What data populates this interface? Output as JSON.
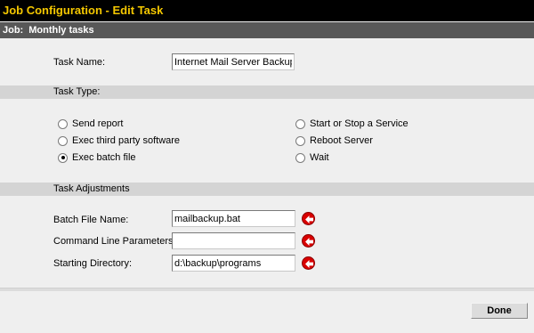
{
  "window": {
    "title": "Job Configuration - Edit Task"
  },
  "job": {
    "prefix": "Job:",
    "name": "Monthly tasks"
  },
  "task_name": {
    "label": "Task Name:",
    "value": "Internet Mail Server Backup"
  },
  "task_type": {
    "header": "Task Type:",
    "selected": "Exec batch file",
    "options": [
      {
        "label": "Send report",
        "checked": false
      },
      {
        "label": "Exec third party software",
        "checked": false
      },
      {
        "label": "Exec batch file",
        "checked": true
      },
      {
        "label": "Start or Stop a Service",
        "checked": false
      },
      {
        "label": "Reboot Server",
        "checked": false
      },
      {
        "label": "Wait",
        "checked": false
      }
    ]
  },
  "adjustments": {
    "header": "Task Adjustments",
    "fields": [
      {
        "label": "Batch File Name:",
        "value": "mailbackup.bat",
        "icon": "arrow-left-icon"
      },
      {
        "label": "Command Line Parameters:",
        "value": "",
        "icon": "arrow-left-icon"
      },
      {
        "label": "Starting Directory:",
        "value": "d:\\backup\\programs",
        "icon": "arrow-left-icon"
      }
    ]
  },
  "actions": {
    "done_label": "Done"
  },
  "colors": {
    "title_bg": "#000000",
    "title_text": "#f5c800",
    "job_bar_bg": "#585858",
    "section_bg": "#d4d4d4",
    "page_bg": "#efefef",
    "arrow_icon": "#d90000"
  }
}
